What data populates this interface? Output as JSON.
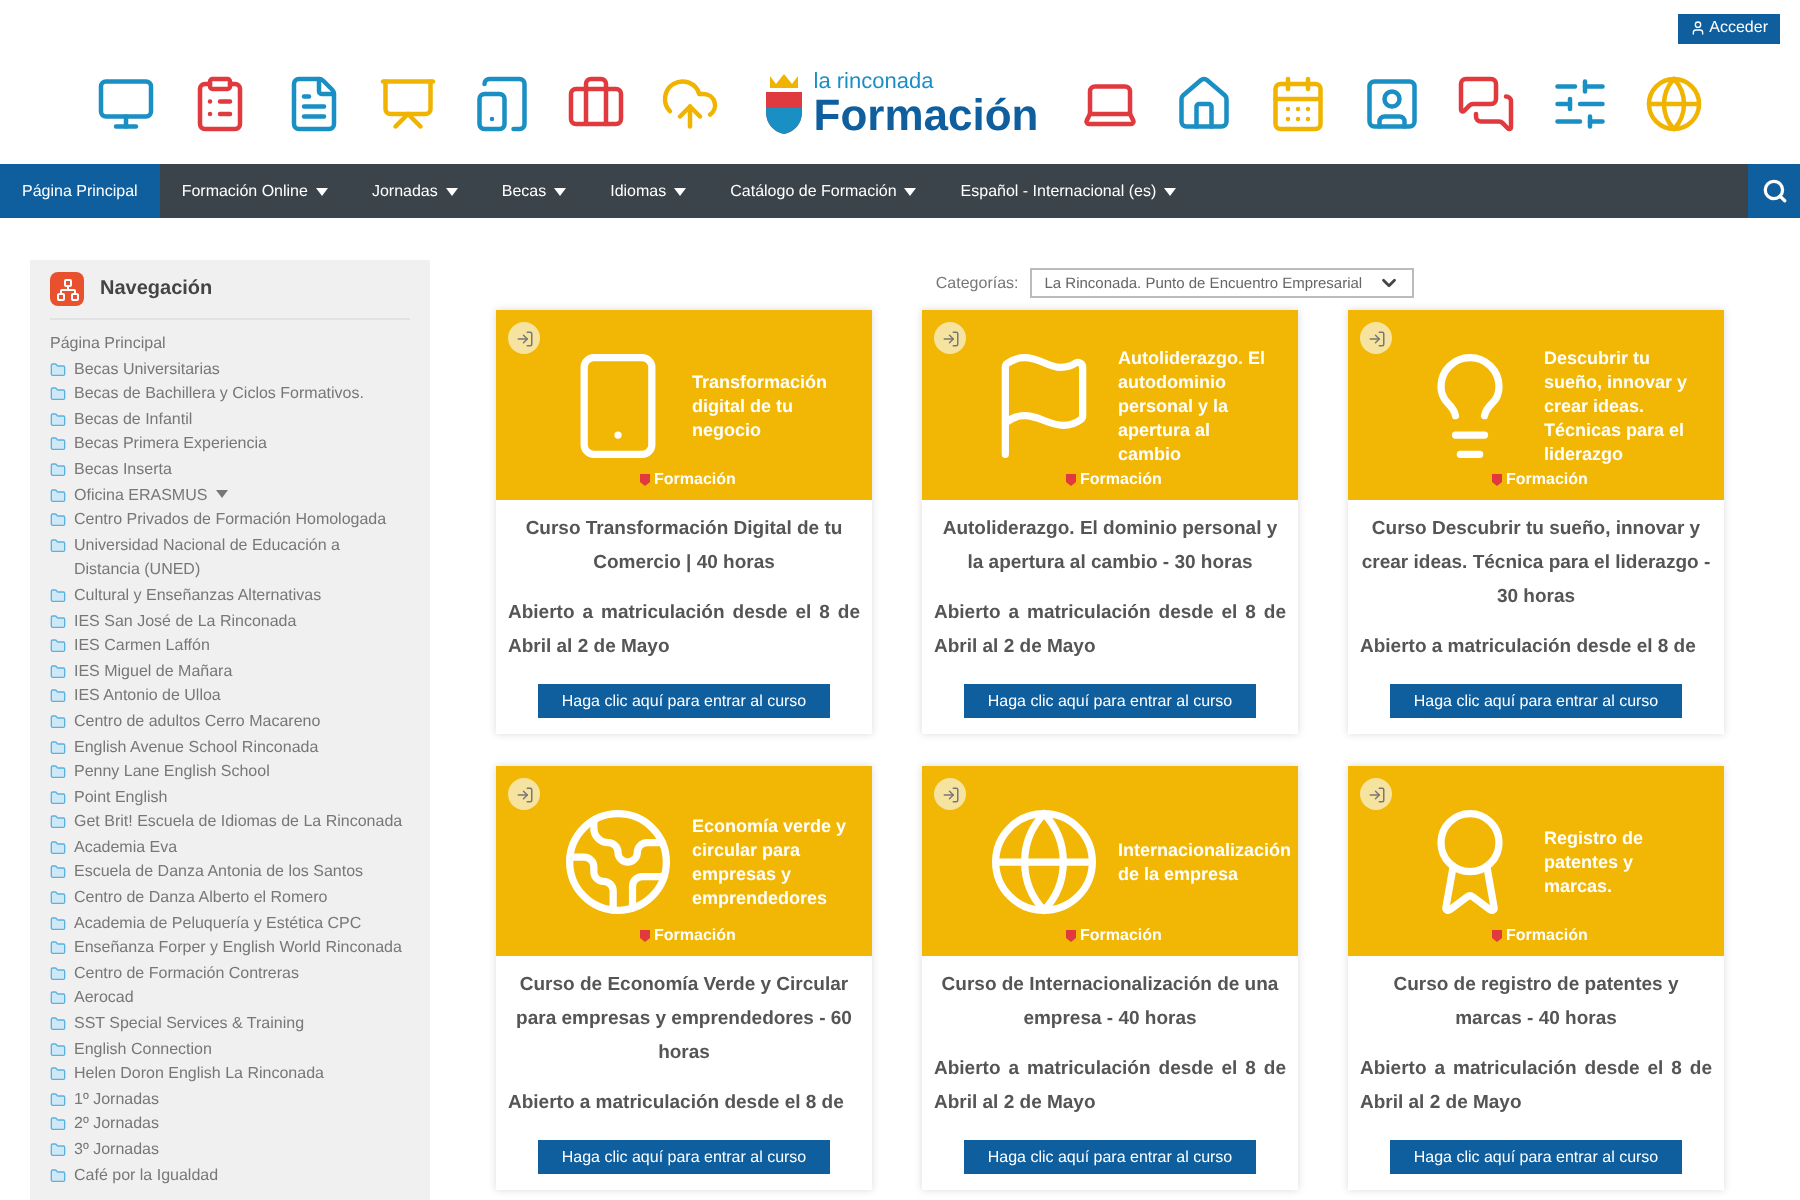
{
  "top_bar": {
    "login_button": "Acceder"
  },
  "logo": {
    "subtitle": "la rinconada",
    "title": "Formación"
  },
  "nav": {
    "items": [
      {
        "label": "Página Principal",
        "selected": true,
        "has_menu": false
      },
      {
        "label": "Formación Online",
        "selected": false,
        "has_menu": true
      },
      {
        "label": "Jornadas",
        "selected": false,
        "has_menu": true
      },
      {
        "label": "Becas",
        "selected": false,
        "has_menu": true
      },
      {
        "label": "Idiomas",
        "selected": false,
        "has_menu": true
      },
      {
        "label": "Catálogo de Formación",
        "selected": false,
        "has_menu": true
      },
      {
        "label": "Español - Internacional (es)",
        "selected": false,
        "has_menu": true
      }
    ]
  },
  "sidebar": {
    "title": "Navegación",
    "items": [
      {
        "label": "Página Principal",
        "kind": "plain",
        "has_menu": false
      },
      {
        "label": "Becas Universitarias",
        "kind": "folder",
        "has_menu": false
      },
      {
        "label": "Becas de Bachillera y Ciclos Formativos.",
        "kind": "folder",
        "has_menu": false
      },
      {
        "label": "Becas de Infantil",
        "kind": "folder",
        "has_menu": false
      },
      {
        "label": "Becas Primera Experiencia",
        "kind": "folder",
        "has_menu": false
      },
      {
        "label": "Becas Inserta",
        "kind": "folder",
        "has_menu": false
      },
      {
        "label": "Oficina ERASMUS",
        "kind": "folder",
        "has_menu": true
      },
      {
        "label": "Centro Privados de Formación Homologada",
        "kind": "folder",
        "has_menu": false
      },
      {
        "label": "Universidad Nacional de Educación a Distancia (UNED)",
        "kind": "folder",
        "has_menu": false
      },
      {
        "label": "Cultural y Enseñanzas Alternativas",
        "kind": "folder",
        "has_menu": false
      },
      {
        "label": "IES San José de La Rinconada",
        "kind": "folder",
        "has_menu": false
      },
      {
        "label": "IES Carmen Laffón",
        "kind": "folder",
        "has_menu": false
      },
      {
        "label": "IES Miguel de Mañara",
        "kind": "folder",
        "has_menu": false
      },
      {
        "label": "IES Antonio de Ulloa",
        "kind": "folder",
        "has_menu": false
      },
      {
        "label": "Centro de adultos Cerro Macareno",
        "kind": "folder",
        "has_menu": false
      },
      {
        "label": "English Avenue School Rinconada",
        "kind": "folder",
        "has_menu": false
      },
      {
        "label": "Penny Lane English School",
        "kind": "folder",
        "has_menu": false
      },
      {
        "label": "Point English",
        "kind": "folder",
        "has_menu": false
      },
      {
        "label": "Get Brit! Escuela de Idiomas de La Rinconada",
        "kind": "folder",
        "has_menu": false
      },
      {
        "label": "Academia Eva",
        "kind": "folder",
        "has_menu": false
      },
      {
        "label": "Escuela de Danza Antonia de los Santos",
        "kind": "folder",
        "has_menu": false
      },
      {
        "label": "Centro de Danza Alberto el Romero",
        "kind": "folder",
        "has_menu": false
      },
      {
        "label": "Academia de Peluquería y Estética CPC",
        "kind": "folder",
        "has_menu": false
      },
      {
        "label": "Enseñanza Forper y English World Rinconada",
        "kind": "folder",
        "has_menu": false
      },
      {
        "label": "Centro de Formación Contreras",
        "kind": "folder",
        "has_menu": false
      },
      {
        "label": "Aerocad",
        "kind": "folder",
        "has_menu": false
      },
      {
        "label": "SST Special Services & Training",
        "kind": "folder",
        "has_menu": false
      },
      {
        "label": "English Connection",
        "kind": "folder",
        "has_menu": false
      },
      {
        "label": "Helen Doron English La Rinconada",
        "kind": "folder",
        "has_menu": false
      },
      {
        "label": "1º Jornadas",
        "kind": "folder",
        "has_menu": false
      },
      {
        "label": "2º Jornadas",
        "kind": "folder",
        "has_menu": false
      },
      {
        "label": "3º Jornadas",
        "kind": "folder",
        "has_menu": false
      },
      {
        "label": "Café por la Igualdad",
        "kind": "folder",
        "has_menu": false
      }
    ]
  },
  "category_filter": {
    "label": "Categorías:",
    "value": "La Rinconada. Punto de Encuentro Empresarial"
  },
  "courses": [
    {
      "kind": "phone",
      "banner_title": "Transformación digital de tu negocio",
      "banner_brand": "Formación",
      "title": "Curso Transformación Digital de tu Comercio | 40 horas",
      "description": "Abierto a matriculación desde el 8 de Abril al 2 de Mayo",
      "button": "Haga clic aquí para entrar al curso"
    },
    {
      "kind": "flag",
      "banner_title": "Autoliderazgo. El autodominio personal y la apertura al cambio",
      "banner_brand": "Formación",
      "title": "Autoliderazgo. El dominio personal y la apertura al cambio - 30 horas",
      "description": "Abierto a matriculación desde el 8 de Abril al 2 de Mayo",
      "button": "Haga clic aquí para entrar al curso"
    },
    {
      "kind": "bulb",
      "banner_title": "Descubrir tu sueño, innovar y crear ideas. Técnicas para el liderazgo",
      "banner_brand": "Formación",
      "title": "Curso Descubrir tu sueño, innovar y crear ideas. Técnica para el liderazgo - 30 horas",
      "description": "Abierto a matriculación desde el 8 de",
      "button": "Haga clic aquí para entrar al curso"
    },
    {
      "kind": "earth",
      "banner_title": "Economía verde y circular para empresas y emprendedores",
      "banner_brand": "Formación",
      "title": "Curso de Economía Verde y Circular para empresas y emprendedores - 60 horas",
      "description": "Abierto a matriculación desde el 8 de",
      "button": "Haga clic aquí para entrar al curso"
    },
    {
      "kind": "globe",
      "banner_title": "Internacionalización de la empresa",
      "banner_brand": "Formación",
      "title": "Curso de Internacionalización de una empresa - 40 horas",
      "description": "Abierto a matriculación desde el 8 de Abril al 2 de Mayo",
      "button": "Haga clic aquí para entrar al curso"
    },
    {
      "kind": "award",
      "banner_title": "Registro de patentes y marcas.",
      "banner_brand": "Formación",
      "title": "Curso de registro de patentes y marcas - 40 horas",
      "description": "Abierto a matriculación desde el 8 de Abril al 2 de Mayo",
      "button": "Haga clic aquí para entrar al curso"
    }
  ]
}
